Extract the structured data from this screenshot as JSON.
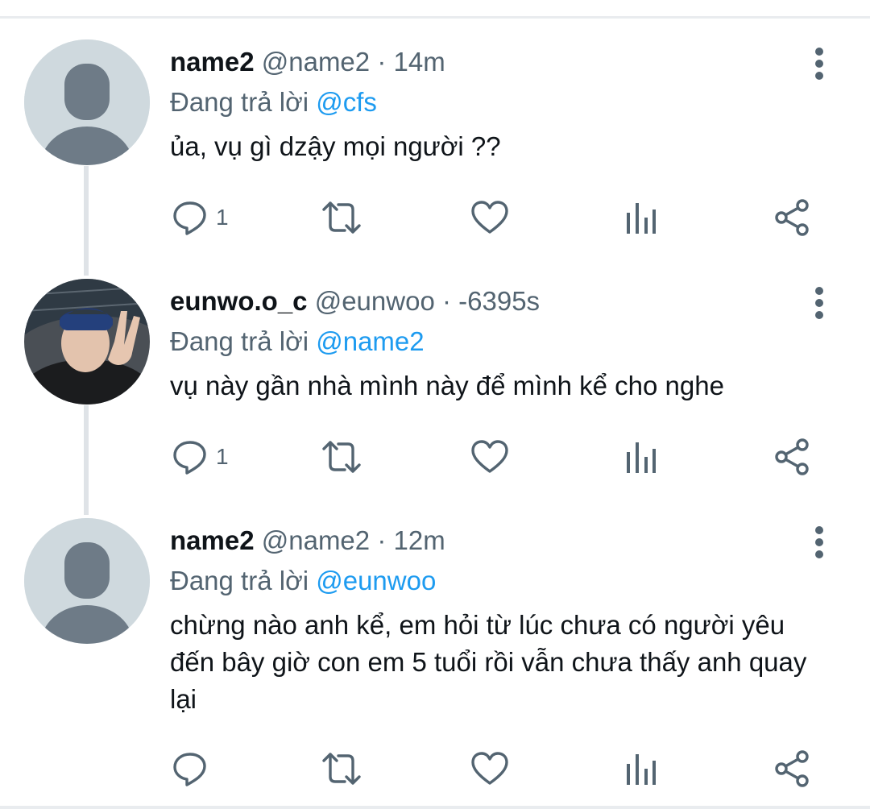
{
  "tweets": [
    {
      "name": "name2",
      "handle": "@name2",
      "separator": "·",
      "time": "14m",
      "reply_prefix": "Đang trả lời",
      "reply_to": "@cfs",
      "text": "ủa, vụ gì dzậy mọi người ??",
      "reply_count": "1",
      "avatar": "default-avatar"
    },
    {
      "name": "eunwo.o_c",
      "handle": "@eunwoo",
      "separator": "·",
      "time": "-6395s",
      "reply_prefix": "Đang trả lời",
      "reply_to": "@name2",
      "text": "vụ này gần nhà mình này để mình kể cho nghe",
      "reply_count": "1",
      "avatar": "photo-avatar"
    },
    {
      "name": "name2",
      "handle": "@name2",
      "separator": "·",
      "time": "12m",
      "reply_prefix": "Đang trả lời",
      "reply_to": "@eunwoo",
      "text": "chừng nào anh kể, em hỏi từ lúc chưa có người yêu đến bây giờ con em 5 tuổi rồi vẫn chưa thấy anh quay lại",
      "reply_count": "",
      "avatar": "default-avatar"
    }
  ],
  "icons": [
    "reply-icon",
    "retweet-icon",
    "like-icon",
    "analytics-icon",
    "share-icon",
    "more-options-icon"
  ],
  "colors": {
    "mention": "#1d9bf0",
    "secondary_text": "#536471",
    "primary_text": "#0f1419",
    "thread_line": "#dfe3e7",
    "avatar_bg": "#cfd9de",
    "avatar_fg": "#6e7b87"
  }
}
